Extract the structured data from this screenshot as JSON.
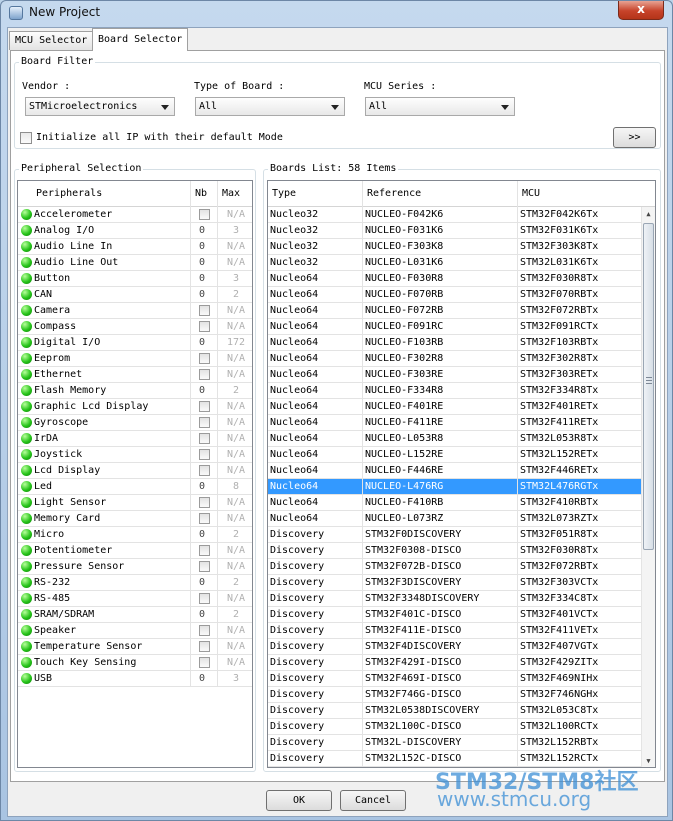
{
  "window": {
    "title": "New Project",
    "close_label": "x"
  },
  "tabs": [
    {
      "label": "MCU Selector",
      "active": false
    },
    {
      "label": "Board Selector",
      "active": true
    }
  ],
  "board_filter": {
    "title": "Board Filter",
    "vendor": {
      "label": "Vendor :",
      "value": "STMicroelectronics"
    },
    "board_type": {
      "label": "Type of Board :",
      "value": "All"
    },
    "mcu_series": {
      "label": "MCU Series :",
      "value": "All"
    },
    "init_ip_label": "Initialize all IP with their default Mode",
    "init_ip_checked": false,
    "expand_label": ">>"
  },
  "peripheral_selection": {
    "title": "Peripheral Selection",
    "columns": [
      "Peripherals",
      "Nb",
      "Max"
    ],
    "items": [
      {
        "name": "Accelerometer",
        "nb": "",
        "max": "N/A"
      },
      {
        "name": "Analog I/O",
        "nb": "0",
        "max": "3"
      },
      {
        "name": "Audio Line In",
        "nb": "0",
        "max": "N/A"
      },
      {
        "name": "Audio Line Out",
        "nb": "0",
        "max": "N/A"
      },
      {
        "name": "Button",
        "nb": "0",
        "max": "3"
      },
      {
        "name": "CAN",
        "nb": "0",
        "max": "2"
      },
      {
        "name": "Camera",
        "nb": "",
        "max": "N/A"
      },
      {
        "name": "Compass",
        "nb": "",
        "max": "N/A"
      },
      {
        "name": "Digital I/O",
        "nb": "0",
        "max": "172"
      },
      {
        "name": "Eeprom",
        "nb": "",
        "max": "N/A"
      },
      {
        "name": "Ethernet",
        "nb": "",
        "max": "N/A"
      },
      {
        "name": "Flash Memory",
        "nb": "0",
        "max": "2"
      },
      {
        "name": "Graphic Lcd Display",
        "nb": "",
        "max": "N/A"
      },
      {
        "name": "Gyroscope",
        "nb": "",
        "max": "N/A"
      },
      {
        "name": "IrDA",
        "nb": "",
        "max": "N/A"
      },
      {
        "name": "Joystick",
        "nb": "",
        "max": "N/A"
      },
      {
        "name": "Lcd Display",
        "nb": "",
        "max": "N/A"
      },
      {
        "name": "Led",
        "nb": "0",
        "max": "8"
      },
      {
        "name": "Light Sensor",
        "nb": "",
        "max": "N/A"
      },
      {
        "name": "Memory Card",
        "nb": "",
        "max": "N/A"
      },
      {
        "name": "Micro",
        "nb": "0",
        "max": "2"
      },
      {
        "name": "Potentiometer",
        "nb": "",
        "max": "N/A"
      },
      {
        "name": "Pressure Sensor",
        "nb": "",
        "max": "N/A"
      },
      {
        "name": "RS-232",
        "nb": "0",
        "max": "2"
      },
      {
        "name": "RS-485",
        "nb": "",
        "max": "N/A"
      },
      {
        "name": "SRAM/SDRAM",
        "nb": "0",
        "max": "2"
      },
      {
        "name": "Speaker",
        "nb": "",
        "max": "N/A"
      },
      {
        "name": "Temperature Sensor",
        "nb": "",
        "max": "N/A"
      },
      {
        "name": "Touch Key Sensing",
        "nb": "",
        "max": "N/A"
      },
      {
        "name": "USB",
        "nb": "0",
        "max": "3"
      }
    ]
  },
  "boards_list": {
    "title": "Boards List: 58 Items",
    "columns": [
      "Type",
      "Reference",
      "MCU"
    ],
    "selected_index": 17,
    "rows": [
      [
        "Nucleo32",
        "NUCLEO-F042K6",
        "STM32F042K6Tx"
      ],
      [
        "Nucleo32",
        "NUCLEO-F031K6",
        "STM32F031K6Tx"
      ],
      [
        "Nucleo32",
        "NUCLEO-F303K8",
        "STM32F303K8Tx"
      ],
      [
        "Nucleo32",
        "NUCLEO-L031K6",
        "STM32L031K6Tx"
      ],
      [
        "Nucleo64",
        "NUCLEO-F030R8",
        "STM32F030R8Tx"
      ],
      [
        "Nucleo64",
        "NUCLEO-F070RB",
        "STM32F070RBTx"
      ],
      [
        "Nucleo64",
        "NUCLEO-F072RB",
        "STM32F072RBTx"
      ],
      [
        "Nucleo64",
        "NUCLEO-F091RC",
        "STM32F091RCTx"
      ],
      [
        "Nucleo64",
        "NUCLEO-F103RB",
        "STM32F103RBTx"
      ],
      [
        "Nucleo64",
        "NUCLEO-F302R8",
        "STM32F302R8Tx"
      ],
      [
        "Nucleo64",
        "NUCLEO-F303RE",
        "STM32F303RETx"
      ],
      [
        "Nucleo64",
        "NUCLEO-F334R8",
        "STM32F334R8Tx"
      ],
      [
        "Nucleo64",
        "NUCLEO-F401RE",
        "STM32F401RETx"
      ],
      [
        "Nucleo64",
        "NUCLEO-F411RE",
        "STM32F411RETx"
      ],
      [
        "Nucleo64",
        "NUCLEO-L053R8",
        "STM32L053R8Tx"
      ],
      [
        "Nucleo64",
        "NUCLEO-L152RE",
        "STM32L152RETx"
      ],
      [
        "Nucleo64",
        "NUCLEO-F446RE",
        "STM32F446RETx"
      ],
      [
        "Nucleo64",
        "NUCLEO-L476RG",
        "STM32L476RGTx"
      ],
      [
        "Nucleo64",
        "NUCLEO-F410RB",
        "STM32F410RBTx"
      ],
      [
        "Nucleo64",
        "NUCLEO-L073RZ",
        "STM32L073RZTx"
      ],
      [
        "Discovery",
        "STM32F0DISCOVERY",
        "STM32F051R8Tx"
      ],
      [
        "Discovery",
        "STM32F0308-DISCO",
        "STM32F030R8Tx"
      ],
      [
        "Discovery",
        "STM32F072B-DISCO",
        "STM32F072RBTx"
      ],
      [
        "Discovery",
        "STM32F3DISCOVERY",
        "STM32F303VCTx"
      ],
      [
        "Discovery",
        "STM32F3348DISCOVERY",
        "STM32F334C8Tx"
      ],
      [
        "Discovery",
        "STM32F401C-DISCO",
        "STM32F401VCTx"
      ],
      [
        "Discovery",
        "STM32F411E-DISCO",
        "STM32F411VETx"
      ],
      [
        "Discovery",
        "STM32F4DISCOVERY",
        "STM32F407VGTx"
      ],
      [
        "Discovery",
        "STM32F429I-DISCO",
        "STM32F429ZITx"
      ],
      [
        "Discovery",
        "STM32F469I-DISCO",
        "STM32F469NIHx"
      ],
      [
        "Discovery",
        "STM32F746G-DISCO",
        "STM32F746NGHx"
      ],
      [
        "Discovery",
        "STM32L0538DISCOVERY",
        "STM32L053C8Tx"
      ],
      [
        "Discovery",
        "STM32L100C-DISCO",
        "STM32L100RCTx"
      ],
      [
        "Discovery",
        "STM32L-DISCOVERY",
        "STM32L152RBTx"
      ],
      [
        "Discovery",
        "STM32L152C-DISCO",
        "STM32L152RCTx"
      ]
    ]
  },
  "footer": {
    "ok_label": "OK",
    "cancel_label": "Cancel"
  },
  "watermark": {
    "line1": "STM32/STM8社区",
    "line2": "www.stmcu.org"
  },
  "colors": {
    "selection": "#3399ff",
    "status_dot": "#27c41a",
    "watermark": "#3d8fd6"
  }
}
